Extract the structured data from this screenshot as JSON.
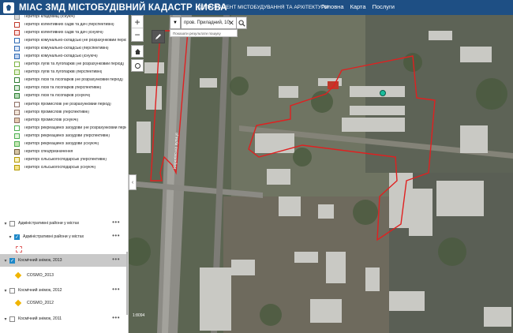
{
  "header": {
    "title": "МІАС ЗМД МІСТОБУДІВНИЙ КАДАСТР КИЄВА",
    "department": "ДЕПАРТАМЕНТ МІСТОБУДУВАННЯ ТА АРХІТЕКТУРИ",
    "nav": [
      "Головна",
      "Карта",
      "Послуги"
    ]
  },
  "legend": [
    {
      "label": "Територї кладовищ (існуюч)",
      "color": "#d9d9d9"
    },
    {
      "label": "Територї колективних садів та дач (перспективні)",
      "color": "#ffffff",
      "border": "#c0392b"
    },
    {
      "label": "Територї колективних садів та дач (існуючі)",
      "color": "#ffe1e1",
      "border": "#c0392b"
    },
    {
      "label": "Територї комунально-складські (не розрахунковий період)",
      "color": "#ffffff",
      "border": "#2e6ab3"
    },
    {
      "label": "Територї комунально-складські (перспективні)",
      "color": "#dfe8f7",
      "border": "#2e6ab3"
    },
    {
      "label": "Територї комунально-складські (існуючі)",
      "color": "#c2d4f0",
      "border": "#2e6ab3"
    },
    {
      "label": "Територї лугів та лугопарків (не розрахунковий період)",
      "color": "#ffffff",
      "border": "#7cb342"
    },
    {
      "label": "Територї лугів та лугопарків (перспективні)",
      "color": "#e5f3d6",
      "border": "#7cb342"
    },
    {
      "label": "Територї лісів та лісопарків (не розрахунковий період)",
      "color": "#ffffff",
      "border": "#2e7d32"
    },
    {
      "label": "Територї лісів та лісопарків (перспективні)",
      "color": "#ddeede",
      "border": "#2e7d32"
    },
    {
      "label": "Територї лісів та лісопарків (існуючі)",
      "color": "#b7dbb8",
      "border": "#2e7d32"
    },
    {
      "label": "Територї промислові (не розрахунковий період)",
      "color": "#ffffff",
      "border": "#8d6e63"
    },
    {
      "label": "Територї промислові (перспективні)",
      "color": "#f3e5d8",
      "border": "#8d6e63"
    },
    {
      "label": "Територї промислові (існуючі)",
      "color": "#e4c9ae",
      "border": "#8d6e63"
    },
    {
      "label": "Територї рекреаційної забудови (не розрахунковий період)",
      "color": "#ffffff",
      "border": "#4caf50"
    },
    {
      "label": "Територї рекреаційної забудови (перспективні)",
      "color": "#e6f5e0",
      "border": "#4caf50"
    },
    {
      "label": "Територї рекреаційної забудови (існуючі)",
      "color": "#c6e8b4",
      "border": "#4caf50"
    },
    {
      "label": "Територї спецпризначення",
      "color": "#d7c6a5",
      "border": "#6d5b3a"
    },
    {
      "label": "Територї сільськогосподарські (перспективні)",
      "color": "#fbf3c2",
      "border": "#b59a00"
    },
    {
      "label": "Територї сільськогосподарські (існуючі)",
      "color": "#f4e38a",
      "border": "#b59a00"
    }
  ],
  "layers": {
    "admin_districts": "Адміністративні райони у містах",
    "admin_districts_sub": "Адміністративні райони у містах",
    "sat_2013": "Космічний знімок, 2013",
    "cosmo_2013": "COSMO_2013",
    "sat_2012": "Космічний знімок, 2012",
    "cosmo_2012": "COSMO_2012",
    "sat_2011": "Космічний знімок, 2011"
  },
  "map": {
    "search_value": "пров. Приладний, 10",
    "search_hint": "Показати результати пошуку",
    "street_label": "Кирилівська вулиця",
    "scale_label": "1:8094"
  }
}
